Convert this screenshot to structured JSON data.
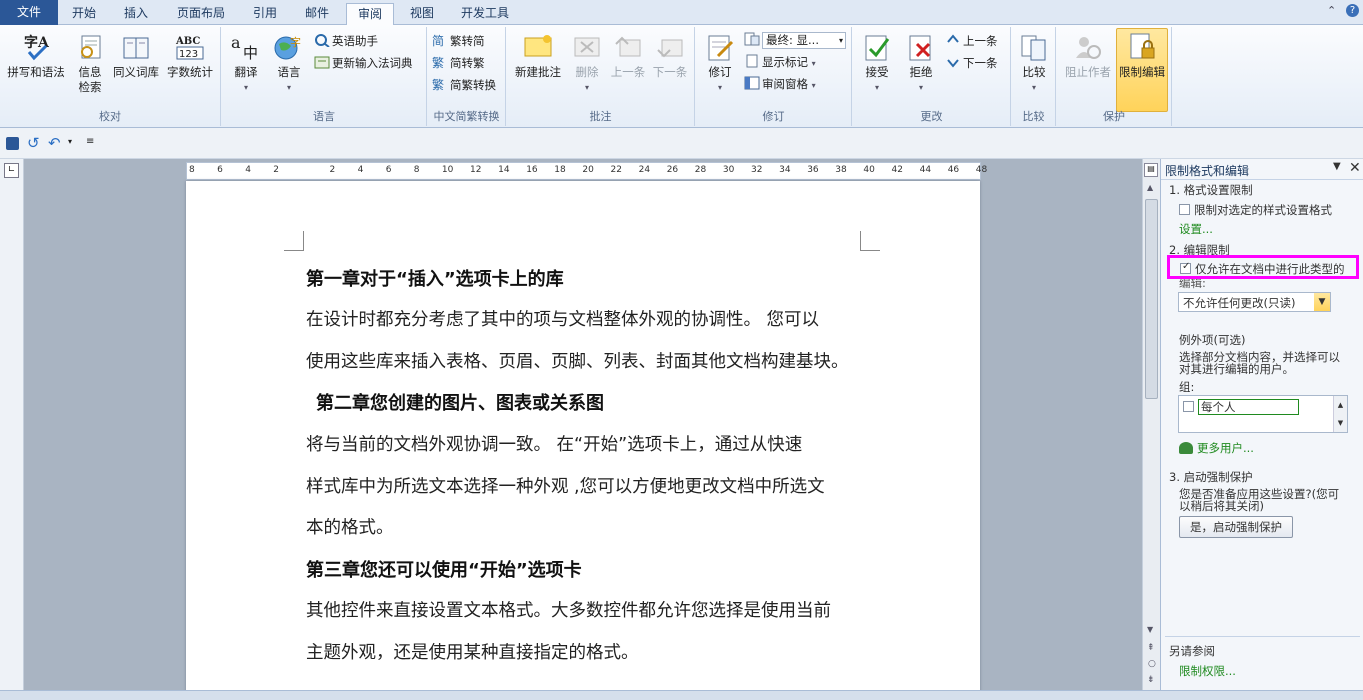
{
  "tabs": [
    "文件",
    "开始",
    "插入",
    "页面布局",
    "引用",
    "邮件",
    "审阅",
    "视图",
    "开发工具"
  ],
  "groups": {
    "proofing": {
      "label": "校对",
      "spelling": "拼写和语法",
      "research1": "信息",
      "research2": "检索",
      "thesaurus": "同义词库",
      "wordcount": "字数统计"
    },
    "language": {
      "label": "语言",
      "translate": "翻译",
      "language": "语言",
      "english_assistant": "英语助手",
      "update_ime": "更新输入法词典"
    },
    "chinese": {
      "label": "中文简繁转换",
      "to_simplified": "繁转简",
      "to_traditional": "简转繁",
      "convert": "简繁转换"
    },
    "comments": {
      "label": "批注",
      "new": "新建批注",
      "delete": "删除",
      "previous": "上一条",
      "next": "下一条"
    },
    "tracking": {
      "label": "修订",
      "track": "修订",
      "final_label": "最终: 显...",
      "show_markup": "显示标记",
      "review_pane": "审阅窗格"
    },
    "changes": {
      "label": "更改",
      "accept": "接受",
      "reject": "拒绝",
      "previous": "上一条",
      "next": "下一条"
    },
    "compare": {
      "label": "比较",
      "compare": "比较"
    },
    "protect": {
      "label": "保护",
      "block_authors": "阻止作者",
      "restrict_editing": "限制编辑"
    }
  },
  "ruler_numbers": [
    "8",
    "6",
    "4",
    "2",
    "",
    "2",
    "4",
    "6",
    "8",
    "10",
    "12",
    "14",
    "16",
    "18",
    "20",
    "22",
    "24",
    "26",
    "28",
    "30",
    "32",
    "34",
    "36",
    "38",
    "40",
    "42",
    "44",
    "46",
    "48"
  ],
  "document": {
    "heading1": "第一章对于“插入”选项卡上的库",
    "p1a": "在设计时都充分考虑了其中的项与文档整体外观的协调性。 您可以",
    "p1b": "使用这些库来插入表格、页眉、页脚、列表、封面其他文档构建基块。",
    "heading2": "第二章您创建的图片、图表或关系图",
    "p2a": "将与当前的文档外观协调一致。 在“开始”选项卡上，通过从快速",
    "p2b": "样式库中为所选文本选择一种外观 ,您可以方便地更改文档中所选文",
    "p2c": "本的格式。",
    "heading3": "第三章您还可以使用“开始”选项卡",
    "p3a": "其他控件来直接设置文本格式。大多数控件都允许您选择是使用当前",
    "p3b": "主题外观，还是使用某种直接指定的格式。"
  },
  "pane": {
    "title": "限制格式和编辑",
    "s1": "1. 格式设置限制",
    "s1_check": "限制对选定的样式设置格式",
    "s1_link": "设置...",
    "s2": "2. 编辑限制",
    "s2_check": "仅允许在文档中进行此类型的",
    "s2_check2": "编辑:",
    "s2_select": "不允许任何更改(只读)",
    "exceptions": "例外项(可选)",
    "exc_desc1": "选择部分文档内容，并选择可以",
    "exc_desc2": "对其进行编辑的用户。",
    "group_label": "组:",
    "group_item": "每个人",
    "more_users": "更多用户...",
    "s3": "3. 启动强制保护",
    "s3_q1": "您是否准备应用这些设置?(您可",
    "s3_q2": "以稍后将其关闭)",
    "s3_btn": "是，启动强制保护",
    "see_also": "另请参阅",
    "restrict_link": "限制权限..."
  },
  "colors": {
    "accent": "#2b5797",
    "highlight": "#ff00ff",
    "link": "#1f8a1f"
  }
}
